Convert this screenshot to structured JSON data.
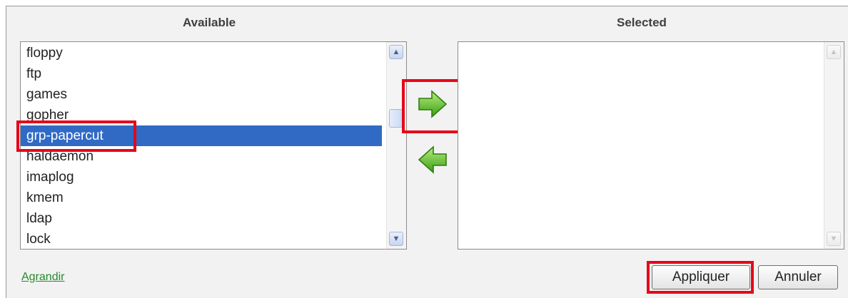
{
  "available": {
    "header": "Available",
    "items": [
      {
        "label": "floppy",
        "selected": false
      },
      {
        "label": "ftp",
        "selected": false
      },
      {
        "label": "games",
        "selected": false
      },
      {
        "label": "gopher",
        "selected": false
      },
      {
        "label": "grp-papercut",
        "selected": true
      },
      {
        "label": "haldaemon",
        "selected": false
      },
      {
        "label": "imaplog",
        "selected": false
      },
      {
        "label": "kmem",
        "selected": false
      },
      {
        "label": "ldap",
        "selected": false
      },
      {
        "label": "lock",
        "selected": false
      }
    ]
  },
  "selected_list": {
    "header": "Selected",
    "items": []
  },
  "controls": {
    "add_icon": "right-arrow-icon",
    "remove_icon": "left-arrow-icon"
  },
  "footer": {
    "expand_link": "Agrandir",
    "apply_label": "Appliquer",
    "cancel_label": "Annuler"
  },
  "colors": {
    "selection": "#316ac5",
    "highlight_box": "#e5081a",
    "arrow_green": "#5cc62b",
    "link": "#238b2d"
  }
}
